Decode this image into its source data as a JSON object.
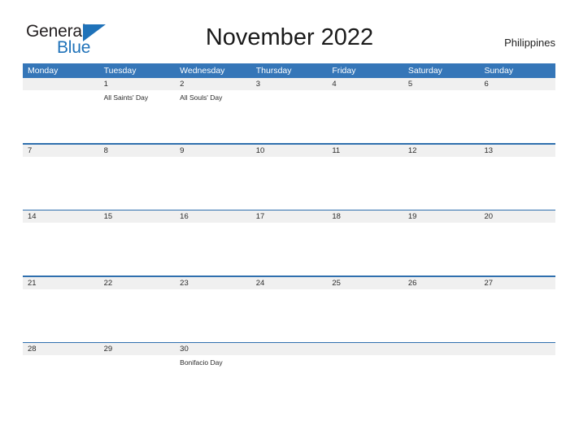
{
  "logo": {
    "text_top": "General",
    "text_bottom": "Blue",
    "triangle_color": "#1f72b9",
    "top_color": "#231f20"
  },
  "header": {
    "title": "November 2022",
    "locale": "Philippines"
  },
  "theme": {
    "header_blue": "#3576b8",
    "rule_blue": "#2f6fae",
    "date_band_gray": "#f0f0f0",
    "text_dark": "#2b2b2b",
    "background": "#ffffff"
  },
  "calendar": {
    "month": "November",
    "year": "2022",
    "weekday_headers": [
      "Monday",
      "Tuesday",
      "Wednesday",
      "Thursday",
      "Friday",
      "Saturday",
      "Sunday"
    ],
    "weeks": [
      {
        "days": [
          {
            "date": "",
            "event": ""
          },
          {
            "date": "1",
            "event": "All Saints' Day"
          },
          {
            "date": "2",
            "event": "All Souls' Day"
          },
          {
            "date": "3",
            "event": ""
          },
          {
            "date": "4",
            "event": ""
          },
          {
            "date": "5",
            "event": ""
          },
          {
            "date": "6",
            "event": ""
          }
        ]
      },
      {
        "days": [
          {
            "date": "7",
            "event": ""
          },
          {
            "date": "8",
            "event": ""
          },
          {
            "date": "9",
            "event": ""
          },
          {
            "date": "10",
            "event": ""
          },
          {
            "date": "11",
            "event": ""
          },
          {
            "date": "12",
            "event": ""
          },
          {
            "date": "13",
            "event": ""
          }
        ]
      },
      {
        "days": [
          {
            "date": "14",
            "event": ""
          },
          {
            "date": "15",
            "event": ""
          },
          {
            "date": "16",
            "event": ""
          },
          {
            "date": "17",
            "event": ""
          },
          {
            "date": "18",
            "event": ""
          },
          {
            "date": "19",
            "event": ""
          },
          {
            "date": "20",
            "event": ""
          }
        ]
      },
      {
        "days": [
          {
            "date": "21",
            "event": ""
          },
          {
            "date": "22",
            "event": ""
          },
          {
            "date": "23",
            "event": ""
          },
          {
            "date": "24",
            "event": ""
          },
          {
            "date": "25",
            "event": ""
          },
          {
            "date": "26",
            "event": ""
          },
          {
            "date": "27",
            "event": ""
          }
        ]
      },
      {
        "days": [
          {
            "date": "28",
            "event": ""
          },
          {
            "date": "29",
            "event": ""
          },
          {
            "date": "30",
            "event": "Bonifacio Day"
          },
          {
            "date": "",
            "event": ""
          },
          {
            "date": "",
            "event": ""
          },
          {
            "date": "",
            "event": ""
          },
          {
            "date": "",
            "event": ""
          }
        ]
      }
    ]
  }
}
